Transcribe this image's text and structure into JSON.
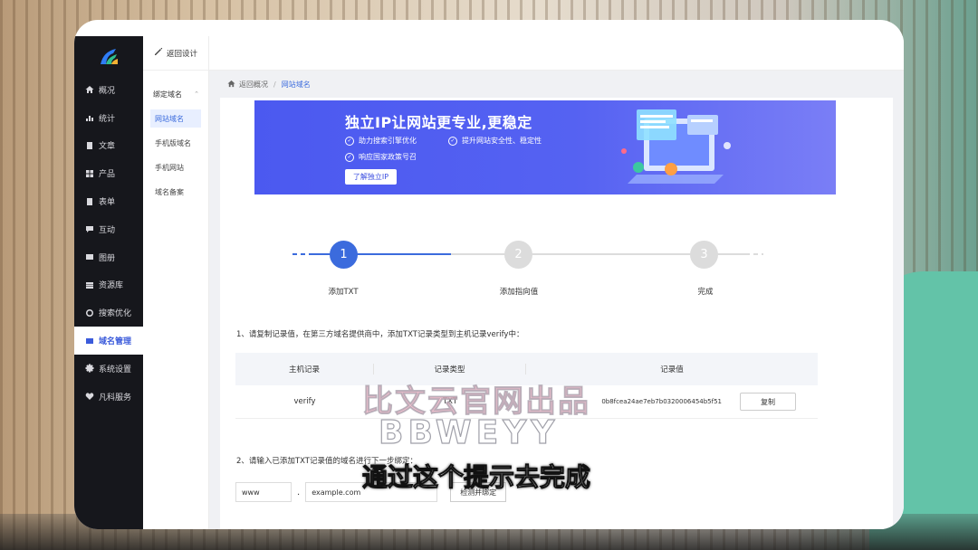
{
  "sidebar": {
    "items": [
      {
        "label": "概况",
        "icon": "home-icon"
      },
      {
        "label": "统计",
        "icon": "chart-icon"
      },
      {
        "label": "文章",
        "icon": "article-icon"
      },
      {
        "label": "产品",
        "icon": "grid-icon"
      },
      {
        "label": "表单",
        "icon": "form-icon"
      },
      {
        "label": "互动",
        "icon": "chat-icon"
      },
      {
        "label": "图册",
        "icon": "image-icon"
      },
      {
        "label": "资源库",
        "icon": "database-icon"
      },
      {
        "label": "搜索优化",
        "icon": "seo-icon"
      },
      {
        "label": "域名管理",
        "icon": "domain-icon",
        "active": true
      },
      {
        "label": "系统设置",
        "icon": "gear-icon"
      },
      {
        "label": "凡科服务",
        "icon": "heart-icon"
      }
    ]
  },
  "subnav": {
    "header": "返回设计",
    "group": "绑定域名",
    "items": [
      "网站域名",
      "手机版域名",
      "手机网站",
      "域名备案"
    ]
  },
  "breadcrumb": {
    "home": "返回概况",
    "separator": "/",
    "current": "网站域名"
  },
  "banner": {
    "title": "独立IP让网站更专业,更稳定",
    "features": [
      "助力搜索引擎优化",
      "提升网站安全性、稳定性",
      "响应国家政策号召"
    ],
    "button": "了解独立IP"
  },
  "steps": [
    {
      "number": "1",
      "label": "添加TXT"
    },
    {
      "number": "2",
      "label": "添加指向值"
    },
    {
      "number": "3",
      "label": "完成"
    }
  ],
  "instruction1": "1、请复制记录值，在第三方域名提供商中，添加TXT记录类型到主机记录verify中：",
  "table": {
    "headers": [
      "主机记录",
      "记录类型",
      "记录值"
    ],
    "row": {
      "host": "verify",
      "type": "TXT",
      "value": "0b8fcea24ae7eb7b0320006454b5f51",
      "copy": "复制"
    }
  },
  "instruction2": "2、请输入已添加TXT记录值的域名进行下一步绑定：",
  "domain_inputs": {
    "prefix": "www",
    "separator": ".",
    "domain": "example.com",
    "button": "检测并绑定"
  },
  "overlay": {
    "watermark_cn": "比文云官网出品",
    "watermark_en": "BBWEYY",
    "subtitle": "通过这个提示去完成"
  }
}
